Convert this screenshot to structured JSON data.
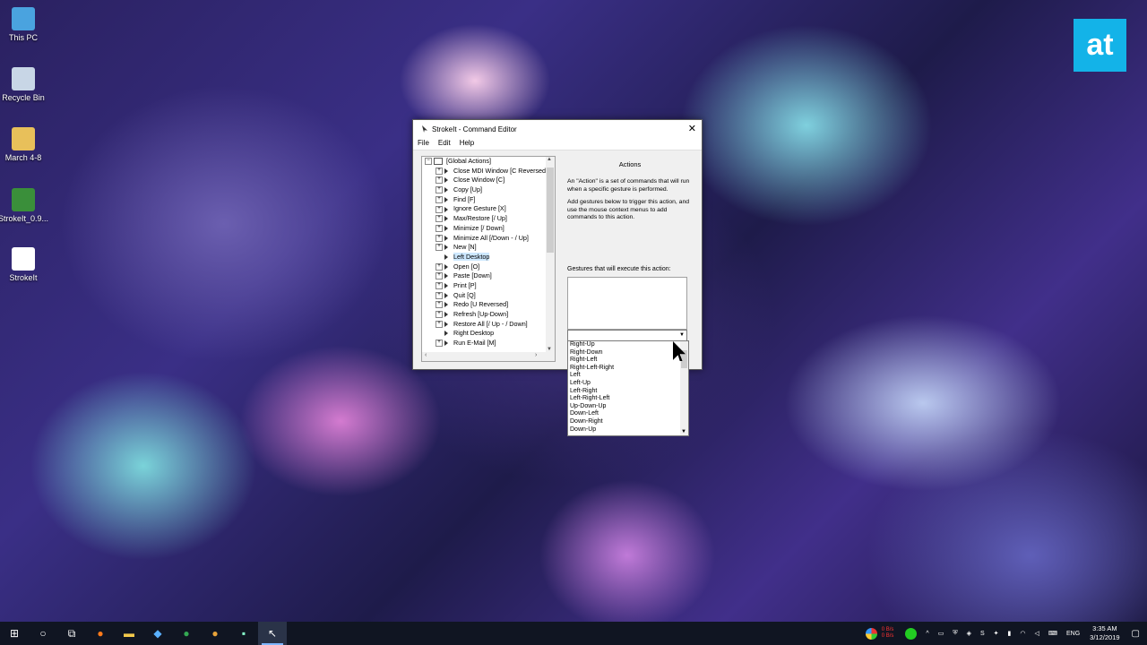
{
  "desktop": {
    "icons": [
      {
        "label": "This PC",
        "color": "#4aa3df"
      },
      {
        "label": "Recycle Bin",
        "color": "#c8d6e6"
      },
      {
        "label": "March 4-8",
        "color": "#e8c05a"
      },
      {
        "label": "StrokeIt_0.9...",
        "color": "#3a8f3a"
      },
      {
        "label": "StrokeIt",
        "color": "#ffffff"
      }
    ],
    "logo_text": "at"
  },
  "window": {
    "title": "StrokeIt - Command Editor",
    "close_glyph": "✕",
    "menu": [
      "File",
      "Edit",
      "Help"
    ],
    "tree": {
      "root": "[Global Actions]",
      "items": [
        "Close MDI Window [C Reversed]",
        "Close Window [C]",
        "Copy [Up]",
        "Find [F]",
        "Ignore Gesture [X]",
        "Max/Restore [/ Up]",
        "Minimize [/ Down]",
        "Minimize All [/Down - / Up]",
        "New [N]",
        "Left Desktop",
        "Open [O]",
        "Paste [Down]",
        "Print [P]",
        "Quit [Q]",
        "Redo [U Reversed]",
        "Refresh [Up-Down]",
        "Restore All [/ Up - / Down]",
        "Right Desktop",
        "Run E-Mail [M]"
      ],
      "selected_index": 9,
      "no_expander_indices": [
        9,
        17
      ]
    },
    "panel": {
      "heading": "Actions",
      "para1": "An \"Action\" is a set of commands that will run when a specific gesture is performed.",
      "para2": "Add gestures below to trigger this action, and use the mouse context menus to add commands to this action.",
      "gestures_label": "Gestures that will execute this action:"
    },
    "combo_value": ""
  },
  "dropdown_options": [
    "Right-Up",
    "Right-Down",
    "Right-Left",
    "Right-Left-Right",
    "Left",
    "Left-Up",
    "Left-Right",
    "Left-Right-Left",
    "Up-Down-Up",
    "Down-Left",
    "Down-Right",
    "Down-Up"
  ],
  "taskbar": {
    "icons": [
      {
        "name": "start-windows-icon",
        "glyph": "⊞",
        "active": false
      },
      {
        "name": "cortana-search-icon",
        "glyph": "○",
        "active": false
      },
      {
        "name": "task-view-icon",
        "glyph": "⧉",
        "active": false
      },
      {
        "name": "firefox-icon",
        "glyph": "●",
        "color": "#ff7a1a",
        "active": false
      },
      {
        "name": "file-explorer-icon",
        "glyph": "▬",
        "color": "#f3c94b",
        "active": false
      },
      {
        "name": "store-icon",
        "glyph": "◆",
        "color": "#5ab0ff",
        "active": false
      },
      {
        "name": "chrome-icon",
        "glyph": "●",
        "color": "#34a853",
        "active": false
      },
      {
        "name": "chrome-canary-icon",
        "glyph": "●",
        "color": "#e8a33a",
        "active": false
      },
      {
        "name": "app-icon",
        "glyph": "▪",
        "color": "#8fc",
        "active": false
      },
      {
        "name": "strokeit-taskbar-icon",
        "glyph": "↖",
        "active": true
      }
    ],
    "netspeed_up": "0 B/s",
    "netspeed_down": "0 B/s",
    "language": "ENG",
    "time": "3:35 AM",
    "date": "3/12/2019"
  }
}
